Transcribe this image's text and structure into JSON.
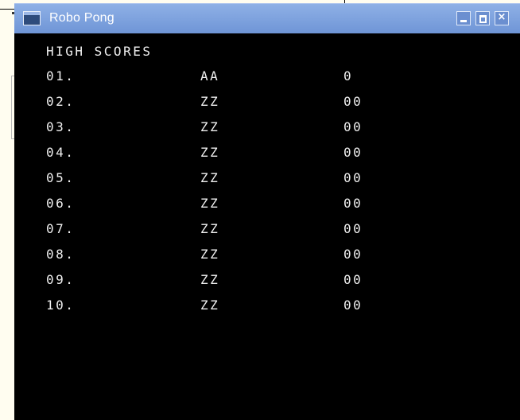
{
  "window": {
    "title": "Robo Pong",
    "controls": {
      "minimize_icon": "minimize-icon",
      "maximize_icon": "maximize-icon",
      "close_icon": "close-icon",
      "close_glyph": "×"
    },
    "colors": {
      "titlebar": "#7aa0de",
      "background": "#000000",
      "text": "#f0f0f0"
    }
  },
  "high_scores": {
    "title": "HIGH SCORES",
    "rows": [
      {
        "rank": "01.",
        "name": "AA",
        "score": "0"
      },
      {
        "rank": "02.",
        "name": "ZZ",
        "score": "00"
      },
      {
        "rank": "03.",
        "name": "ZZ",
        "score": "00"
      },
      {
        "rank": "04.",
        "name": "ZZ",
        "score": "00"
      },
      {
        "rank": "05.",
        "name": "ZZ",
        "score": "00"
      },
      {
        "rank": "06.",
        "name": "ZZ",
        "score": "00"
      },
      {
        "rank": "07.",
        "name": "ZZ",
        "score": "00"
      },
      {
        "rank": "08.",
        "name": "ZZ",
        "score": "00"
      },
      {
        "rank": "09.",
        "name": "ZZ",
        "score": "00"
      },
      {
        "rank": "10.",
        "name": "ZZ",
        "score": "00"
      }
    ]
  }
}
